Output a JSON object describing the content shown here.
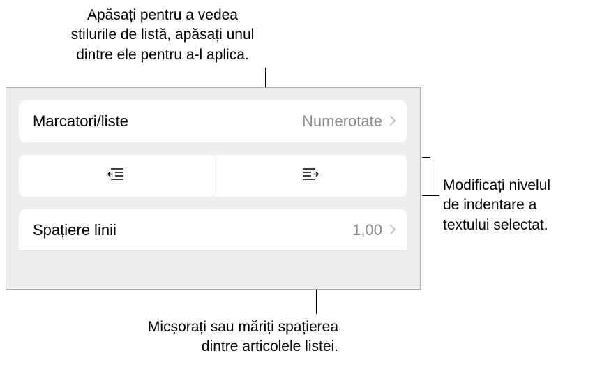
{
  "callouts": {
    "top_l1": "Apăsați pentru a vedea",
    "top_l2": "stilurile de listă, apăsați unul",
    "top_l3": "dintre ele pentru a-l aplica.",
    "right_l1": "Modificați nivelul",
    "right_l2": "de indentare a",
    "right_l3": "textului selectat.",
    "bottom_l1": "Micșorați sau măriți spațierea",
    "bottom_l2": "dintre articolele listei."
  },
  "rows": {
    "bullets_label": "Marcatori/liste",
    "bullets_value": "Numerotate",
    "line_spacing_label": "Spațiere linii",
    "line_spacing_value": "1,00"
  }
}
